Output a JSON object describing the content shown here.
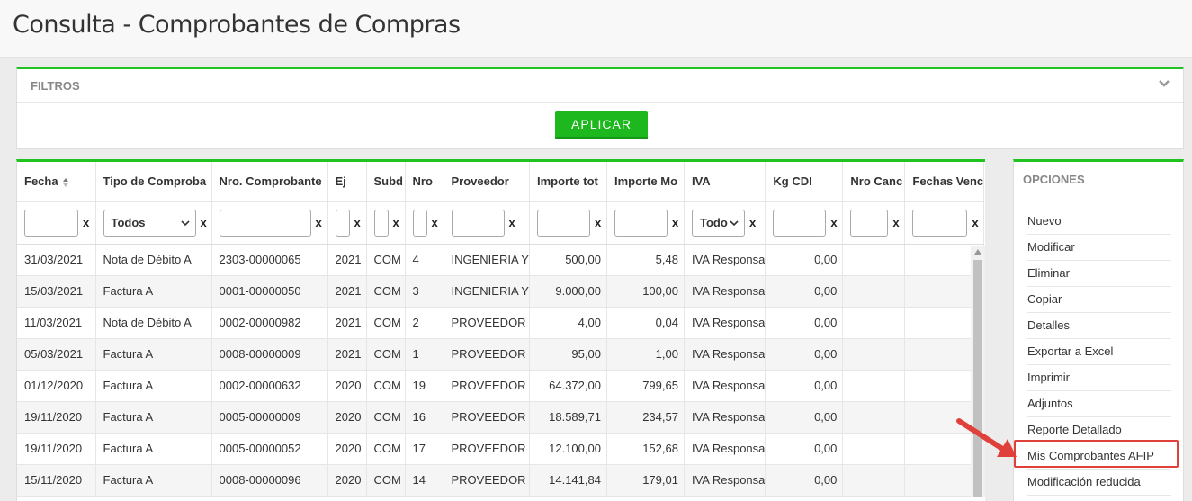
{
  "page": {
    "title": "Consulta - Comprobantes de Compras"
  },
  "filters": {
    "title": "FILTROS",
    "apply_label": "APLICAR"
  },
  "grid": {
    "columns": [
      "Fecha",
      "Tipo de Comproba",
      "Nro. Comprobante",
      "Ej",
      "Subd",
      "Nro",
      "Proveedor",
      "Importe tot",
      "Importe Mo",
      "IVA",
      "Kg CDI",
      "Nro Canc",
      "Fechas Venc"
    ],
    "filter_selects": {
      "tipo": "Todos",
      "iva": "Todo"
    },
    "clear_label": "x",
    "rows": [
      [
        "31/03/2021",
        "Nota de Débito A",
        "2303-00000065",
        "2021",
        "COM",
        "4",
        "INGENIERIA Y",
        "500,00",
        "5,48",
        "IVA Responsa",
        "0,00",
        "",
        ""
      ],
      [
        "15/03/2021",
        "Factura A",
        "0001-00000050",
        "2021",
        "COM",
        "3",
        "INGENIERIA Y",
        "9.000,00",
        "100,00",
        "IVA Responsa",
        "0,00",
        "",
        ""
      ],
      [
        "11/03/2021",
        "Nota de Débito A",
        "0002-00000982",
        "2021",
        "COM",
        "2",
        "PROVEEDOR",
        "4,00",
        "0,04",
        "IVA Responsa",
        "0,00",
        "",
        ""
      ],
      [
        "05/03/2021",
        "Factura A",
        "0008-00000009",
        "2021",
        "COM",
        "1",
        "PROVEEDOR",
        "95,00",
        "1,00",
        "IVA Responsa",
        "0,00",
        "",
        ""
      ],
      [
        "01/12/2020",
        "Factura A",
        "0002-00000632",
        "2020",
        "COM",
        "19",
        "PROVEEDOR",
        "64.372,00",
        "799,65",
        "IVA Responsa",
        "0,00",
        "",
        ""
      ],
      [
        "19/11/2020",
        "Factura A",
        "0005-00000009",
        "2020",
        "COM",
        "16",
        "PROVEEDOR",
        "18.589,71",
        "234,57",
        "IVA Responsa",
        "0,00",
        "",
        ""
      ],
      [
        "19/11/2020",
        "Factura A",
        "0005-00000052",
        "2020",
        "COM",
        "17",
        "PROVEEDOR",
        "12.100,00",
        "152,68",
        "IVA Responsa",
        "0,00",
        "",
        ""
      ],
      [
        "15/11/2020",
        "Factura A",
        "0008-00000096",
        "2020",
        "COM",
        "14",
        "PROVEEDOR",
        "14.141,84",
        "179,01",
        "IVA Responsa",
        "0,00",
        "",
        ""
      ]
    ]
  },
  "options": {
    "title": "OPCIONES",
    "items": [
      "Nuevo",
      "Modificar",
      "Eliminar",
      "Copiar",
      "Detalles",
      "Exportar a Excel",
      "Imprimir",
      "Adjuntos",
      "Reporte Detallado",
      "Mis Comprobantes AFIP",
      "Modificación reducida"
    ],
    "highlighted": "Mis Comprobantes AFIP"
  },
  "colors": {
    "accent": "#21c321",
    "highlight": "#e0403a"
  },
  "icons": {
    "collapse": "chevron-down-icon",
    "sort": "sort-icon",
    "annotation": "red-arrow-icon"
  }
}
